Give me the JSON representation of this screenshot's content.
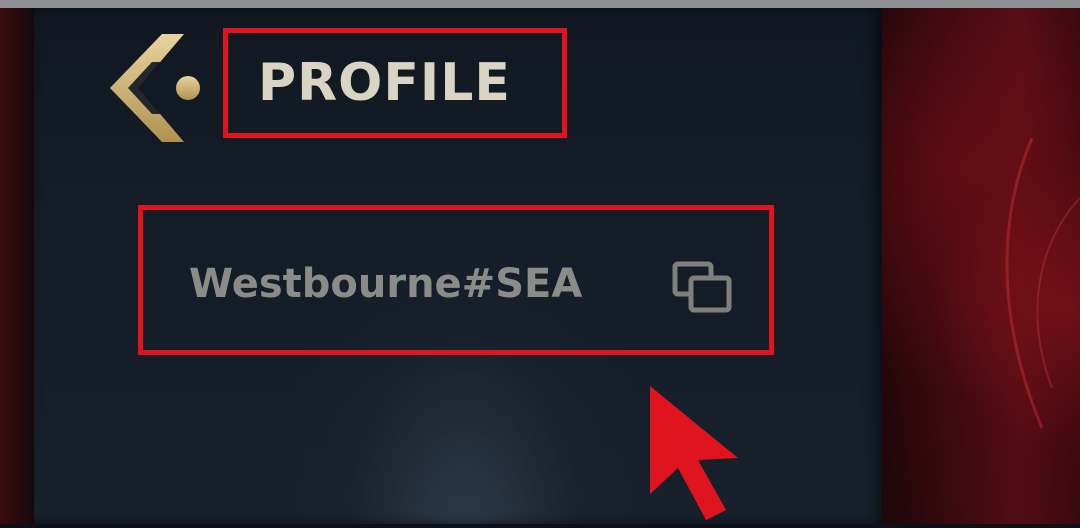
{
  "header": {
    "title": "PROFILE"
  },
  "profile": {
    "riot_id": "Westbourne#SEA"
  },
  "icons": {
    "back": "back-chevron-icon",
    "copy": "copy-icon",
    "pointer": "cursor-arrow-icon"
  },
  "colors": {
    "highlight": "#e0141e",
    "gold": "#c8aa6e",
    "title_text": "#d9d4c3",
    "id_text": "#8b8c88",
    "panel": "#141c26"
  }
}
